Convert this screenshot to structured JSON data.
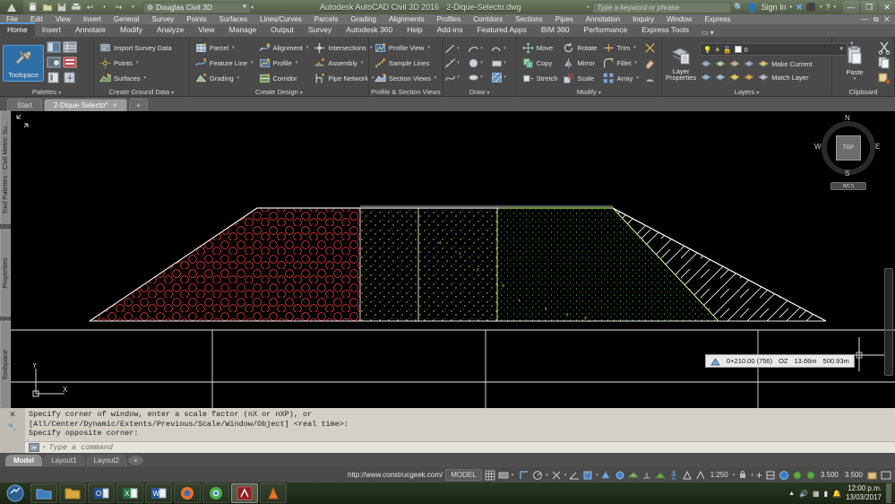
{
  "titlebar": {
    "workspace": "Douglas Civil 3D",
    "app_title": "Autodesk AutoCAD Civil 3D 2016",
    "document": "2-Dique-Selecto.dwg",
    "search_placeholder": "Type a keyword or phrase",
    "signin": "Sign In",
    "quick_access": [
      "new-icon",
      "open-icon",
      "save-icon",
      "plot-icon",
      "undo-icon",
      "redo-icon"
    ],
    "window_buttons": [
      "minimize",
      "maximize",
      "close"
    ]
  },
  "menubar": {
    "items": [
      "File",
      "Edit",
      "View",
      "Insert",
      "General",
      "Survey",
      "Points",
      "Surfaces",
      "Lines/Curves",
      "Parcels",
      "Grading",
      "Alignments",
      "Profiles",
      "Corridors",
      "Sections",
      "Pipes",
      "Annotation",
      "Inquiry",
      "Window",
      "Express"
    ]
  },
  "ribbon_tabs": {
    "items": [
      "Home",
      "Insert",
      "Annotate",
      "Modify",
      "Analyze",
      "View",
      "Manage",
      "Output",
      "Survey",
      "Autodesk 360",
      "Help",
      "Add-ins",
      "Featured Apps",
      "BIM 360",
      "Performance",
      "Express Tools"
    ],
    "active": "Home"
  },
  "ribbon": {
    "panels": [
      {
        "title": "Palettes",
        "big_button": {
          "label": "Toolspace",
          "icon": "toolspace-icon",
          "selected": true
        },
        "small_icons": [
          "toolspace-icon",
          "panorama-icon",
          "properties-icon",
          "tool-palettes-icon",
          "sheet-set-icon",
          "layer-properties-icon"
        ]
      },
      {
        "title": "Create Ground Data",
        "items": [
          {
            "label": "Import Survey Data",
            "icon": "import-survey-icon",
            "dropdown": false
          },
          {
            "label": "Points",
            "icon": "points-icon",
            "dropdown": true
          },
          {
            "label": "Surfaces",
            "icon": "surfaces-icon",
            "dropdown": true
          }
        ]
      },
      {
        "title": "Create Design",
        "col1": [
          {
            "label": "Parcel",
            "icon": "parcel-icon",
            "dropdown": true
          },
          {
            "label": "Feature Line",
            "icon": "feature-line-icon",
            "dropdown": true
          },
          {
            "label": "Grading",
            "icon": "grading-icon",
            "dropdown": true
          }
        ],
        "col2": [
          {
            "label": "Alignment",
            "icon": "alignment-icon",
            "dropdown": true
          },
          {
            "label": "Profile",
            "icon": "profile-icon",
            "dropdown": true
          },
          {
            "label": "Corridor",
            "icon": "corridor-icon",
            "dropdown": false
          }
        ],
        "col3": [
          {
            "label": "Intersections",
            "icon": "intersections-icon",
            "dropdown": true
          },
          {
            "label": "Assembly",
            "icon": "assembly-icon",
            "dropdown": true
          },
          {
            "label": "Pipe Network",
            "icon": "pipe-network-icon",
            "dropdown": true
          }
        ]
      },
      {
        "title": "Profile & Section Views",
        "items": [
          {
            "label": "Profile View",
            "icon": "profile-view-icon",
            "dropdown": true
          },
          {
            "label": "Sample Lines",
            "icon": "sample-lines-icon",
            "dropdown": false
          },
          {
            "label": "Section Views",
            "icon": "section-views-icon",
            "dropdown": true
          }
        ]
      },
      {
        "title": "Draw",
        "icons": [
          "line-icon",
          "arc-icon",
          "polyline-icon",
          "construction-line-icon",
          "circle-icon",
          "rectangle-icon",
          "spline-icon",
          "ellipse-icon",
          "hatch-icon"
        ]
      },
      {
        "title": "Modify",
        "col1": [
          {
            "label": "Move",
            "icon": "move-icon"
          },
          {
            "label": "Copy",
            "icon": "copy-icon"
          },
          {
            "label": "Stretch",
            "icon": "stretch-icon"
          }
        ],
        "col2": [
          {
            "label": "Rotate",
            "icon": "rotate-icon"
          },
          {
            "label": "Mirror",
            "icon": "mirror-icon"
          },
          {
            "label": "Scale",
            "icon": "scale-icon"
          }
        ],
        "col3": [
          {
            "label": "Trim",
            "icon": "trim-icon",
            "dropdown": true
          },
          {
            "label": "Fillet",
            "icon": "fillet-icon",
            "dropdown": true
          },
          {
            "label": "Array",
            "icon": "array-icon",
            "dropdown": true
          }
        ],
        "col4": [
          "explode-icon",
          "erase-icon",
          "offset-icon"
        ]
      },
      {
        "title": "Layers",
        "big_button": {
          "label_line1": "Layer",
          "label_line2": "Properties",
          "icon": "layer-properties-icon"
        },
        "current_layer": "0",
        "layer_state_icons": [
          "lightbulb-on-icon",
          "sun-icon",
          "unlock-icon",
          "color-swatch-icon"
        ],
        "actions": [
          {
            "label": "Make Current",
            "icon": "make-current-icon"
          },
          {
            "label": "Match Layer",
            "icon": "match-layer-icon"
          }
        ]
      },
      {
        "title": "Clipboard",
        "big_button": {
          "label": "Paste",
          "icon": "paste-icon",
          "dropdown": true
        },
        "small_icons": [
          "cut-icon",
          "copy-clip-icon",
          "copy-with-basepoint-icon"
        ]
      }
    ]
  },
  "document_tabs": {
    "items": [
      {
        "label": "Start",
        "active": false,
        "closable": false
      },
      {
        "label": "2-Dique-Selecto*",
        "active": true,
        "closable": true
      }
    ],
    "add_label": "+"
  },
  "left_panels": [
    {
      "label": "Tool Palettes - Civil Metric Su..."
    },
    {
      "label": "Properties"
    },
    {
      "label": "Toolspace"
    }
  ],
  "viewcube": {
    "north": "N",
    "south": "S",
    "east": "E",
    "west": "W",
    "face": "TOP",
    "ucs_label": "WCS"
  },
  "ucs_icon": {
    "y_label": "Y",
    "x_label": "X"
  },
  "tooltip": {
    "icon": "section-view-icon",
    "station": "0+210.00 (756)",
    "code": "OZ",
    "offset": "13.66m",
    "elevation": "500.93m"
  },
  "command_line": {
    "history": [
      "Specify corner of window, enter a scale factor (nX or nXP), or",
      "[All/Center/Dynamic/Extents/Previous/Scale/Window/Object] <real time>:",
      "Specify opposite corner:"
    ],
    "placeholder": "Type a command"
  },
  "layout_tabs": {
    "items": [
      {
        "label": "Model",
        "active": true
      },
      {
        "label": "Layout1",
        "active": false
      },
      {
        "label": "Layout2",
        "active": false
      }
    ],
    "add_label": "+"
  },
  "status_bar": {
    "url": "http://www.construcgeek.com/",
    "space": "MODEL",
    "annotation_scale": "1:250",
    "linewidth_1": "3.500",
    "linewidth_2": "3.500",
    "icons": [
      "grid-icon",
      "snap-icon",
      "ortho-icon",
      "polar-icon",
      "osnap-icon",
      "otrack-icon",
      "ucs-icon",
      "dynamic-ucs-icon",
      "dyn-input-icon",
      "lineweight-icon",
      "transparency-icon",
      "selection-cycling-icon",
      "annotation-visibility-icon",
      "autoscale-icon",
      "workspace-icon",
      "isolate-objects-icon",
      "customization-icon"
    ]
  },
  "taskbar": {
    "start": "start-icon",
    "items": [
      "explorer-icon",
      "folder-icon",
      "outlook-icon",
      "excel-icon",
      "word-icon",
      "firefox-icon",
      "chrome-icon",
      "autocad-icon",
      "vlc-icon"
    ],
    "active_index": 7,
    "tray_icons": [
      "show-hidden-icon",
      "volume-icon",
      "network-icon",
      "battery-icon",
      "action-center-icon"
    ],
    "time": "12:00 p.m.",
    "date": "13/03/2017"
  },
  "drawing": {
    "description": "Civil 3D cross-section view of a dam (dique) embankment with hatched material zones",
    "colors": {
      "riprap_red": "#d93030",
      "filter_green": "#7fdc2a",
      "core_yellow": "#d8d83a",
      "outline_white": "#e8e8e8",
      "background": "#000000"
    }
  }
}
